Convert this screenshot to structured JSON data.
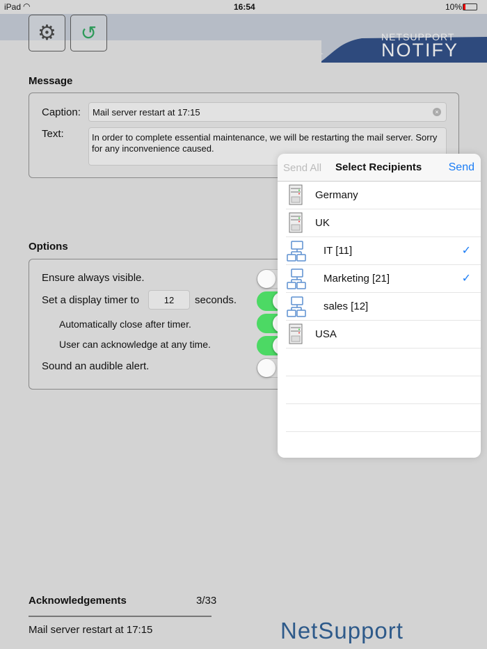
{
  "status_bar": {
    "device": "iPad",
    "time": "16:54",
    "battery": "10%"
  },
  "header": {
    "logo_top": "NETSUPPORT",
    "logo_bottom": "NOTIFY"
  },
  "message": {
    "title": "Message",
    "caption_label": "Caption:",
    "caption_value": "Mail server restart at 17:15",
    "text_label": "Text:",
    "text_value": "In order to complete essential maintenance, we will be restarting the mail server. Sorry for any inconvenience caused."
  },
  "options": {
    "title": "Options",
    "always_visible": "Ensure always visible.",
    "timer_prefix": "Set a display timer to",
    "timer_value": "12",
    "timer_suffix": "seconds.",
    "auto_close": "Automatically close after timer.",
    "acknowledge": "User can acknowledge at any time.",
    "sound": "Sound an audible alert.",
    "toggles": {
      "always_visible": false,
      "timer": true,
      "auto_close": true,
      "acknowledge": true,
      "sound": false
    }
  },
  "popover": {
    "send_all": "Send All",
    "title": "Select Recipients",
    "send": "Send",
    "items": [
      {
        "label": "Germany",
        "icon": "server-icon",
        "checked": false
      },
      {
        "label": "UK",
        "icon": "server-icon",
        "checked": false
      },
      {
        "label": "IT [11]",
        "icon": "group-icon",
        "checked": true
      },
      {
        "label": "Marketing [21]",
        "icon": "group-icon",
        "checked": true
      },
      {
        "label": "sales [12]",
        "icon": "group-icon",
        "checked": false
      },
      {
        "label": "USA",
        "icon": "server-icon",
        "checked": false
      }
    ]
  },
  "acknowledgements": {
    "title": "Acknowledgements",
    "count": "3/33",
    "item": "Mail server restart at 17:15"
  },
  "footer": {
    "logo": "NetSupport"
  },
  "colors": {
    "accent": "#1a7cf5",
    "toggle_on": "#4cd964",
    "brand": "#2e4a7d"
  }
}
